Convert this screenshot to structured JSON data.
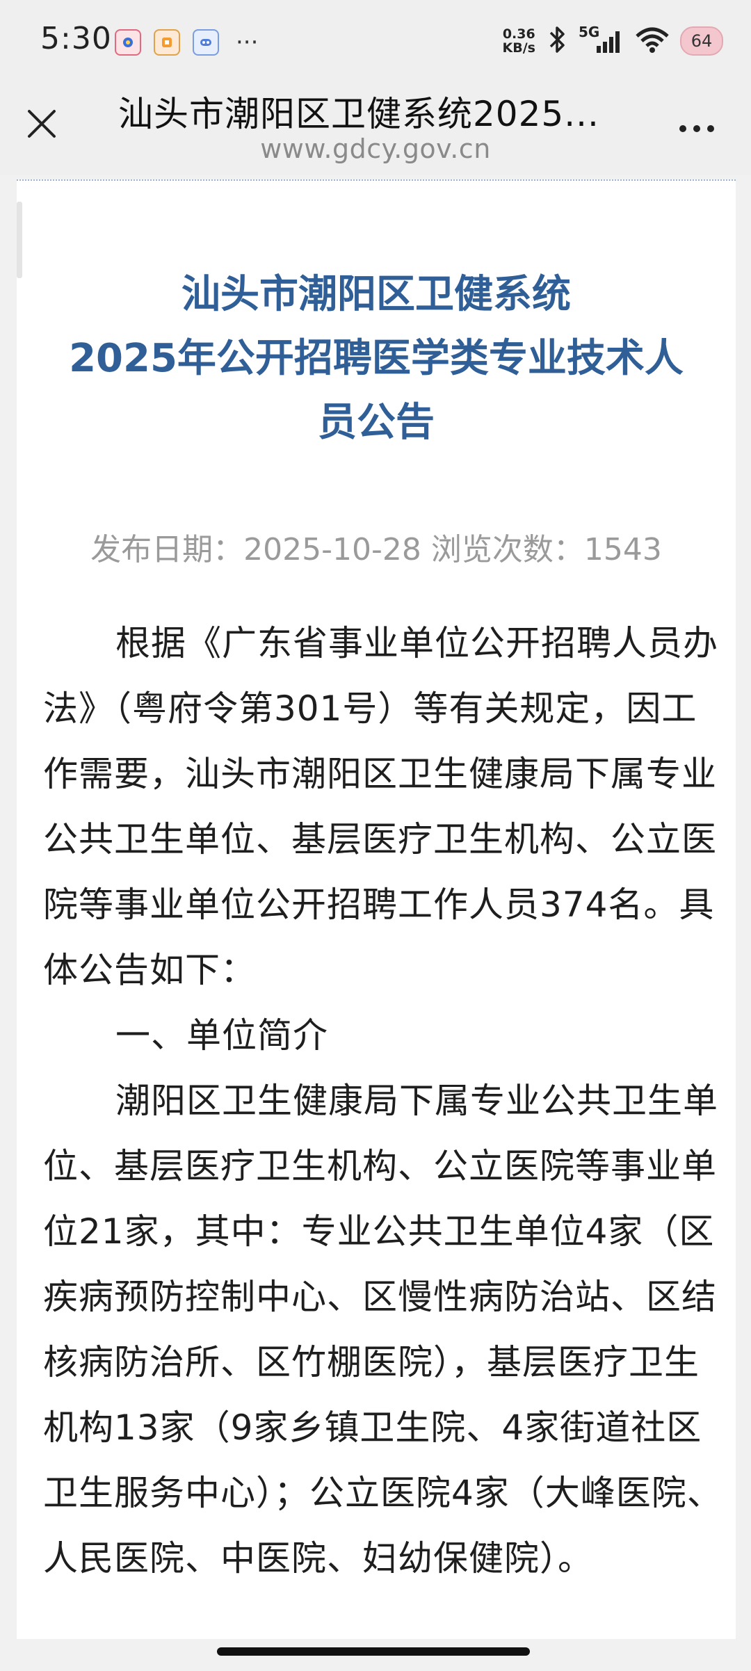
{
  "status_bar": {
    "time": "5:30",
    "network_speed_value": "0.36",
    "network_speed_unit": "KB/s",
    "network_type": "5G",
    "battery_level": "64",
    "more_notifications": "···",
    "icons": [
      "app-notification-icon",
      "app-notification-icon",
      "app-notification-icon",
      "bluetooth-icon",
      "signal-icon",
      "wifi-icon",
      "battery-icon"
    ]
  },
  "header": {
    "title": "汕头市潮阳区卫健系统2025...",
    "url": "www.gdcy.gov.cn"
  },
  "article": {
    "title_line1": "汕头市潮阳区卫健系统",
    "title_line2": "2025年公开招聘医学类专业技术人",
    "title_line3": "员公告",
    "meta": "发布日期：2025-10-28  浏览次数：1543",
    "paragraph1": "根据《广东省事业单位公开招聘人员办法》（粤府令第301号）等有关规定，因工作需要，汕头市潮阳区卫生健康局下属专业公共卫生单位、基层医疗卫生机构、公立医院等事业单位公开招聘工作人员374名。具体公告如下：",
    "section1_heading": "一、单位简介",
    "paragraph2": "潮阳区卫生健康局下属专业公共卫生单位、基层医疗卫生机构、公立医院等事业单位21家，其中：专业公共卫生单位4家（区疾病预防控制中心、区慢性病防治站、区结核病防治所、区竹棚医院），基层医疗卫生机构13家（9家乡镇卫生院、4家街道社区卫生服务中心）；公立医院4家（大峰医院、人民医院、中医院、妇幼保健院）。"
  },
  "colors": {
    "title_blue": "#2f5f96",
    "meta_gray": "#9a9a9a",
    "body_text": "#1e1e1e"
  }
}
